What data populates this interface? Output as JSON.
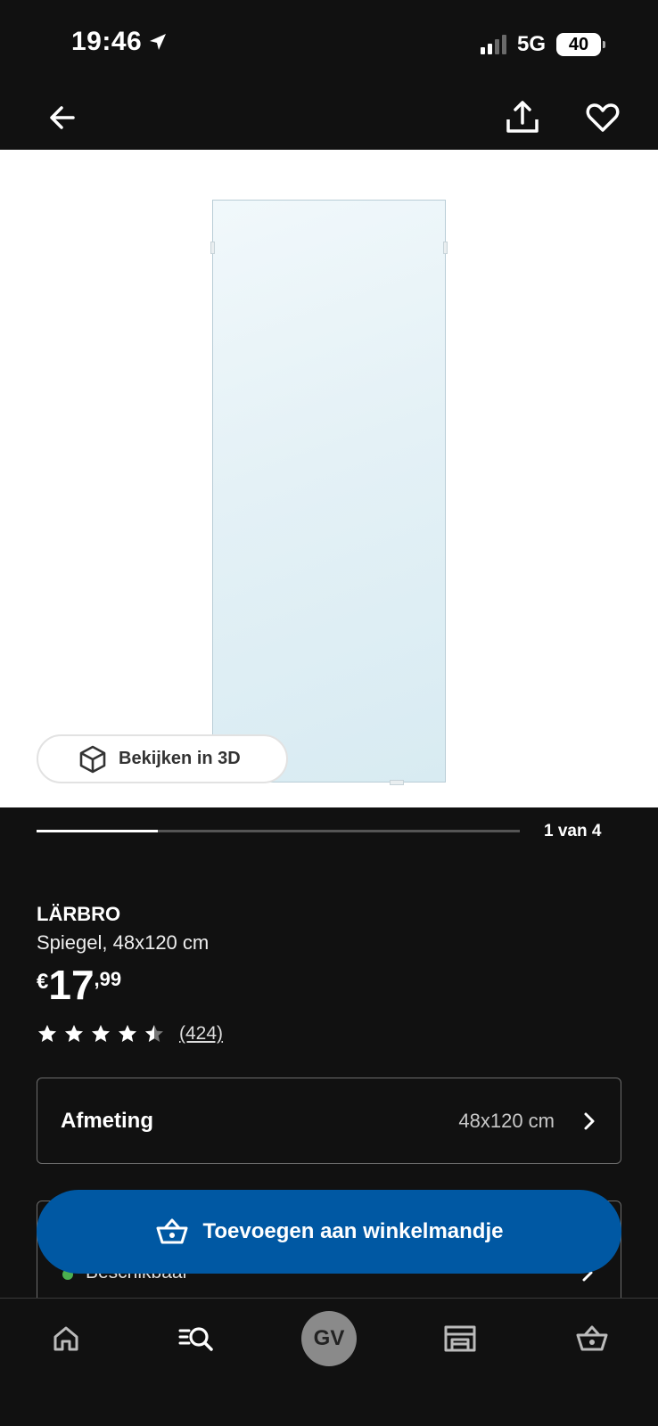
{
  "status_bar": {
    "time": "19:46",
    "network": "5G",
    "battery": "40"
  },
  "nav": {
    "back_icon": "arrow-left-icon",
    "share_icon": "share-icon",
    "favorite_icon": "heart-icon"
  },
  "gallery": {
    "view_3d_label": "Bekijken in 3D",
    "page_counter": "1 van 4",
    "progress": 0.25
  },
  "product": {
    "name": "LÄRBRO",
    "description": "Spiegel, 48x120 cm",
    "price_currency": "€",
    "price_int": "17",
    "price_dec": ",99",
    "rating": 4.5,
    "rating_count": "(424)"
  },
  "size": {
    "label": "Afmeting",
    "value": "48x120 cm"
  },
  "availability": {
    "text": "Beschikbaar",
    "status_color": "#4caf50"
  },
  "cart_button": {
    "label": "Toevoegen aan winkelmandje",
    "color": "#0058a3"
  },
  "bottom_nav": {
    "items": [
      {
        "name": "home",
        "icon": "home-icon"
      },
      {
        "name": "search",
        "icon": "search-list-icon"
      },
      {
        "name": "account",
        "icon": "avatar",
        "initials": "GV"
      },
      {
        "name": "store",
        "icon": "store-icon"
      },
      {
        "name": "cart",
        "icon": "basket-icon"
      }
    ]
  }
}
